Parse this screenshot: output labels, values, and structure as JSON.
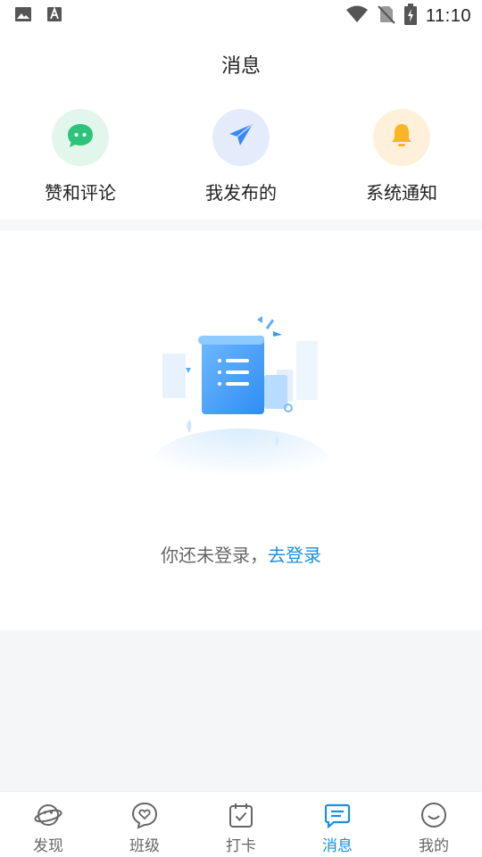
{
  "status_bar": {
    "time": "11:10",
    "left_icons": [
      "image-icon",
      "font-icon"
    ],
    "right_icons": [
      "wifi-icon",
      "no-sim-icon",
      "battery-charging-icon"
    ]
  },
  "header": {
    "title": "消息"
  },
  "entries": [
    {
      "label": "赞和评论",
      "icon": "chat-bubble-icon",
      "bg": "#e3f6ec",
      "color": "#2fc27a"
    },
    {
      "label": "我发布的",
      "icon": "paper-plane-icon",
      "bg": "#e4ecfb",
      "color": "#3a86f5"
    },
    {
      "label": "系统通知",
      "icon": "bell-icon",
      "bg": "#fff1d9",
      "color": "#f9b523"
    }
  ],
  "empty_state": {
    "message": "你还未登录，",
    "link": "去登录"
  },
  "tab_bar": {
    "active": 3,
    "tabs": [
      {
        "label": "发现",
        "icon": "planet-icon"
      },
      {
        "label": "班级",
        "icon": "heart-chat-icon"
      },
      {
        "label": "打卡",
        "icon": "calendar-check-icon"
      },
      {
        "label": "消息",
        "icon": "message-icon"
      },
      {
        "label": "我的",
        "icon": "smile-icon"
      }
    ]
  },
  "colors": {
    "accent": "#1a8fe0",
    "inactive": "#666666"
  }
}
